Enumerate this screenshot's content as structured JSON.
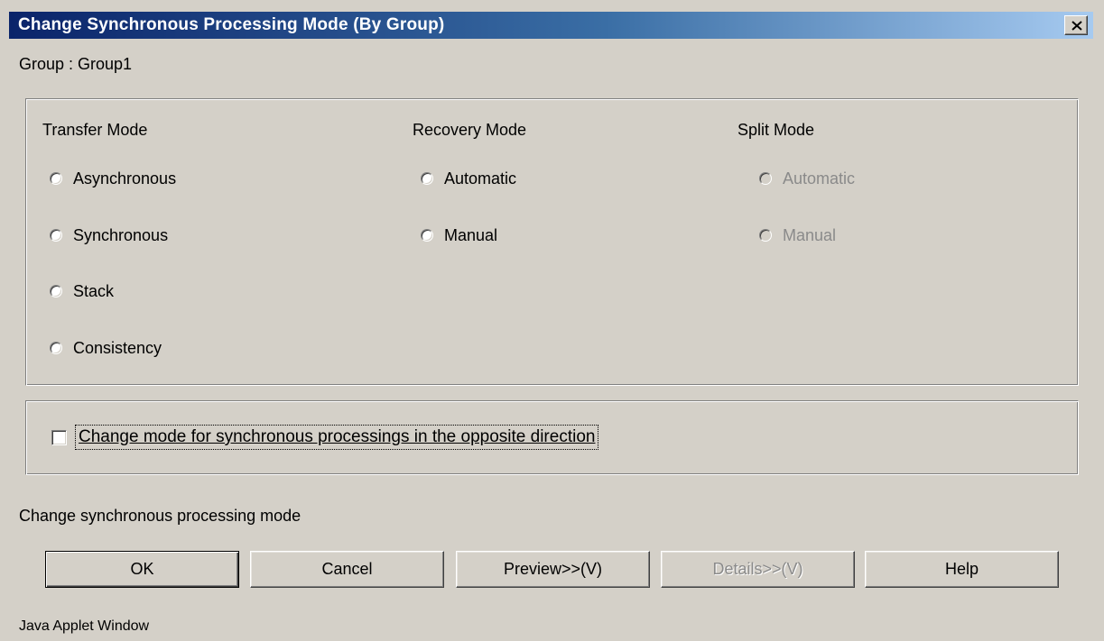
{
  "window": {
    "title": "Change Synchronous Processing Mode (By Group)",
    "close_icon": "close-x-icon",
    "title_gradient": [
      "#0a246a",
      "#a6caf0"
    ],
    "background": "#d4d0c8"
  },
  "group_label": "Group : Group1",
  "modes": {
    "transfer": {
      "title": "Transfer Mode",
      "options": [
        "Asynchronous",
        "Synchronous",
        "Stack",
        "Consistency"
      ]
    },
    "recovery": {
      "title": "Recovery Mode",
      "options": [
        "Automatic",
        "Manual"
      ]
    },
    "split": {
      "title": "Split Mode",
      "options": [
        "Automatic",
        "Manual"
      ],
      "disabled": true
    }
  },
  "opposite_direction": {
    "label": "Change mode for synchronous processings in the opposite direction",
    "checked": false
  },
  "status_text": "Change synchronous processing mode",
  "buttons": {
    "ok": "OK",
    "cancel": "Cancel",
    "preview": "Preview>>(V)",
    "details": "Details>>(V)",
    "help": "Help"
  },
  "footer": "Java Applet Window"
}
